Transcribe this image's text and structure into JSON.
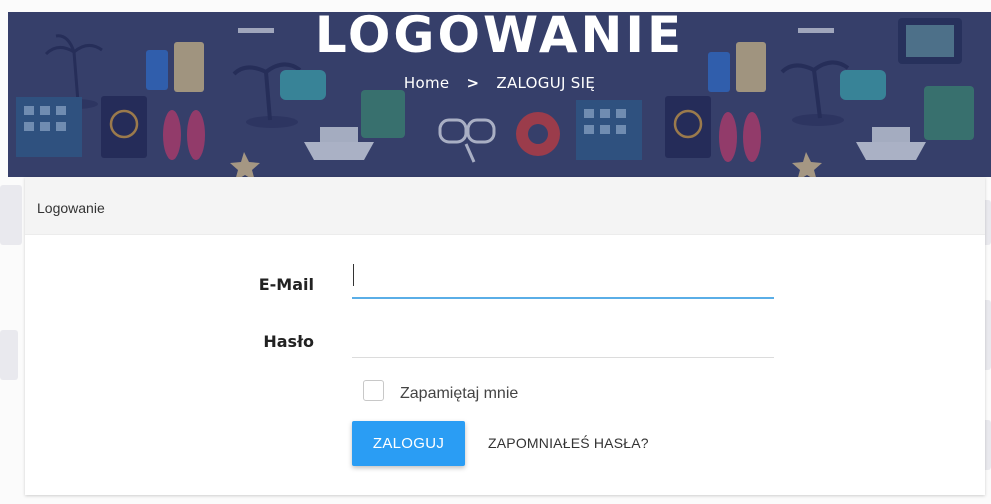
{
  "hero": {
    "title": "LOGOWANIE",
    "breadcrumb": {
      "home": "Home",
      "separator": ">",
      "current": "ZALOGUJ SIĘ"
    },
    "background_color": "#363f6b"
  },
  "card": {
    "header": "Logowanie",
    "email": {
      "label": "E-Mail",
      "value": "",
      "placeholder": ""
    },
    "password": {
      "label": "Hasło",
      "value": "",
      "placeholder": ""
    },
    "remember": {
      "label": "Zapamiętaj mnie",
      "checked": false
    },
    "submit_label": "ZALOGUJ",
    "forgot_label": "ZAPOMNIAŁEŚ HASŁA?"
  },
  "colors": {
    "accent": "#2a9df4",
    "focus_underline": "#5aaee7"
  },
  "icons": [
    "palm-tree-icon",
    "hotel-icon",
    "passport-icon",
    "flip-flops-icon",
    "cruise-ship-icon",
    "suitcase-icon",
    "diving-mask-icon",
    "life-ring-icon",
    "sunscreen-icon",
    "beach-bag-icon",
    "map-icon"
  ]
}
